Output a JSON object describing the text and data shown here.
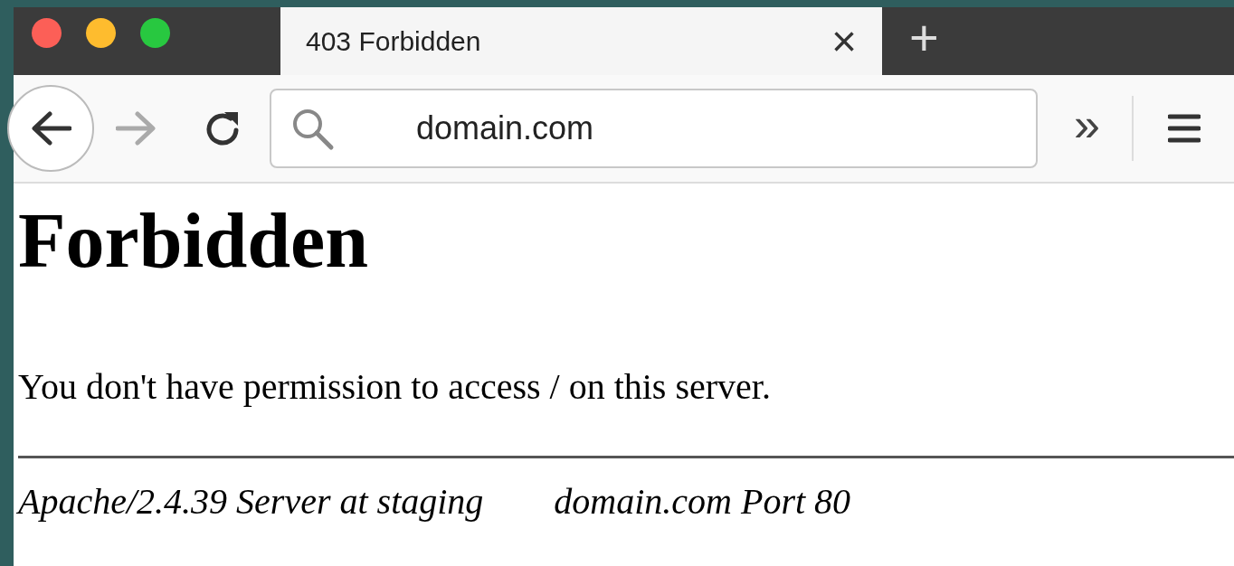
{
  "tabs": [
    {
      "title": "403 Forbidden",
      "selected": true,
      "close": "×"
    }
  ],
  "new_tab": "+",
  "toolbar": {
    "url": "domain.com",
    "overflow": "»"
  },
  "page": {
    "heading": "Forbidden",
    "message": "You don't have permission to access / on this server.",
    "address": [
      "Apache/2.4.39 Server at staging",
      "domain.com Port 80"
    ]
  }
}
